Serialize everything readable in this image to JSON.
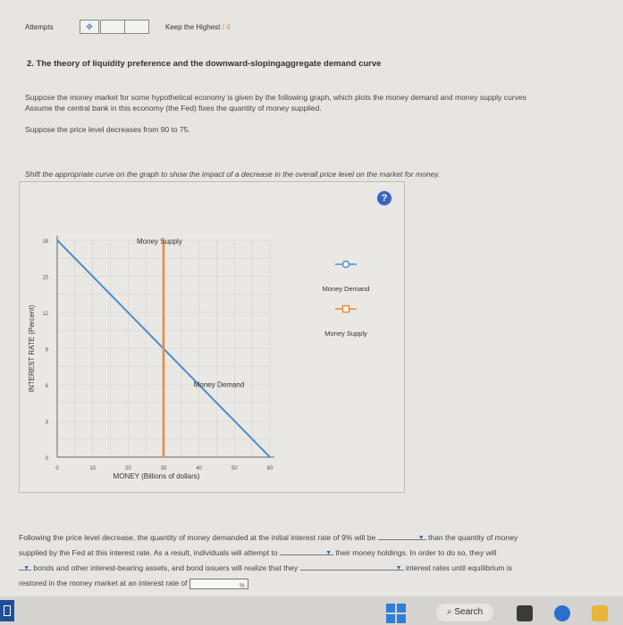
{
  "header": {
    "attempts_label": "Attempts",
    "keep_label": "Keep the Highest",
    "keep_score": "/ 4"
  },
  "question": {
    "title": "2. The theory of liquidity preference and the downward-slopingaggregate demand curve",
    "para1": "Suppose the money market for some hypothetical economy is given by the following graph, which plots the money demand and money supply curves",
    "para2": "Assume the central bank in this economy (the Fed) fixes the quantity of money supplied.",
    "para3": "Suppose the price level decreases from 90 to 75.",
    "instruction": "Shift the appropriate curve on the graph to show the impact of a decrease in the overall price level on the market for money."
  },
  "graph": {
    "help_label": "?",
    "ylabel": "INTEREST RATE (Percent)",
    "xlabel": "MONEY (Billions of dollars)",
    "supply_label": "Money Supply",
    "demand_label": "Money Demand",
    "legend_demand": "Money Demand",
    "legend_supply": "Money Supply",
    "colors": {
      "demand": "#4a8fcf",
      "supply": "#ea8a3a",
      "grid": "#d3d2cd"
    }
  },
  "chart_data": {
    "type": "line",
    "xlabel": "MONEY (Billions of dollars)",
    "ylabel": "INTEREST RATE (Percent)",
    "xlim": [
      0,
      60
    ],
    "ylim": [
      0,
      18
    ],
    "xticks": [
      "0",
      "10",
      "20",
      "30",
      "40",
      "50",
      "60"
    ],
    "yticks": [
      "0",
      "3",
      "6",
      "9",
      "12",
      "15",
      "18"
    ],
    "grid": true,
    "legend": "right",
    "series": [
      {
        "name": "Money Demand",
        "points": [
          [
            0,
            18
          ],
          [
            60,
            0
          ]
        ]
      },
      {
        "name": "Money Supply",
        "points": [
          [
            30,
            0
          ],
          [
            30,
            18
          ]
        ]
      }
    ]
  },
  "bottom": {
    "s1a": "Following the price level decrease, the quantity of money demanded at the initial interest rate of 9% will be",
    "s1b": "than the quantity of money",
    "s2a": "supplied by the Fed at this interest rate. As a result, individuals will attempt to",
    "s2b": "their money holdings. In order to do so, they will",
    "s3a": "bonds and other interest-bearing assets, and bond issuers will realize that they",
    "s3b": "interest rates until equilibrium is",
    "s4a": "restored in the money market at an interest rate of",
    "unit": "%"
  },
  "taskbar": {
    "search_label": "Search"
  }
}
